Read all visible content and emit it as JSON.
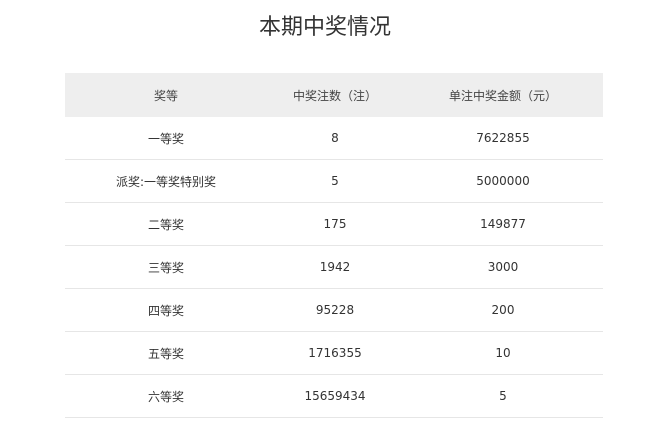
{
  "page_title": "本期中奖情况",
  "table": {
    "headers": [
      "奖等",
      "中奖注数（注）",
      "单注中奖金额（元）"
    ],
    "rows": [
      [
        "一等奖",
        "8",
        "7622855"
      ],
      [
        "派奖:一等奖特别奖",
        "5",
        "5000000"
      ],
      [
        "二等奖",
        "175",
        "149877"
      ],
      [
        "三等奖",
        "1942",
        "3000"
      ],
      [
        "四等奖",
        "95228",
        "200"
      ],
      [
        "五等奖",
        "1716355",
        "10"
      ],
      [
        "六等奖",
        "15659434",
        "5"
      ]
    ]
  },
  "colors": {
    "header_bg": "#eeeeee",
    "row_divider": "#e6e6e6",
    "text": "#333333"
  }
}
